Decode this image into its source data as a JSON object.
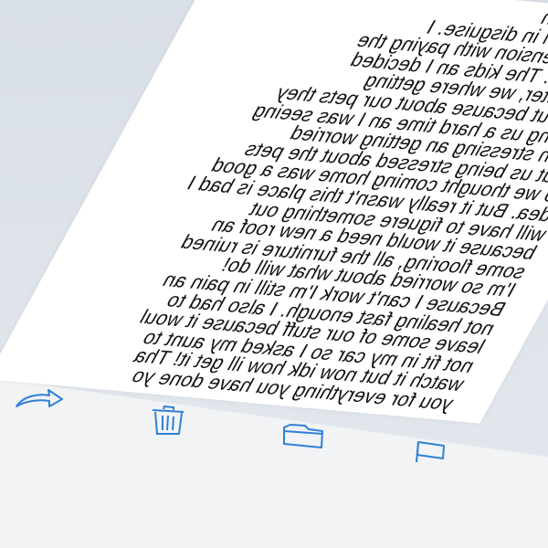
{
  "message": {
    "lines": [
      "e done for an",
      "g and Angel in disguise. I",
      "a little extension with paying the",
      "f my rent. The kids an I decided",
      "the shelter, we where getting",
      "ssed out because about our pets they",
      "e giving us a hard time an I was seeing",
      "y son stressing an getting worried",
      "bout us being stressed about the pets",
      "so we thought coming home was a good",
      "idea. But it really wasn't this place is bad I",
      "will have to figuere something out",
      "because it would need a new roof an",
      "some flooring, all the furniture is ruined",
      "I'm so worried about what will do!",
      "Because I can't work I'm still in pain an",
      "not healing fast enough. I also had to",
      "leave some of our stuff because it woul",
      "not fit in my car so I asked my aunt to",
      "watch it but now idk how ill get it! Tha",
      "you for everything you have done yo"
    ]
  },
  "toolbar": {
    "icons": [
      "reply-arrow-icon",
      "trash-icon",
      "folder-icon",
      "flag-icon"
    ],
    "accent": "#2f80d8"
  }
}
